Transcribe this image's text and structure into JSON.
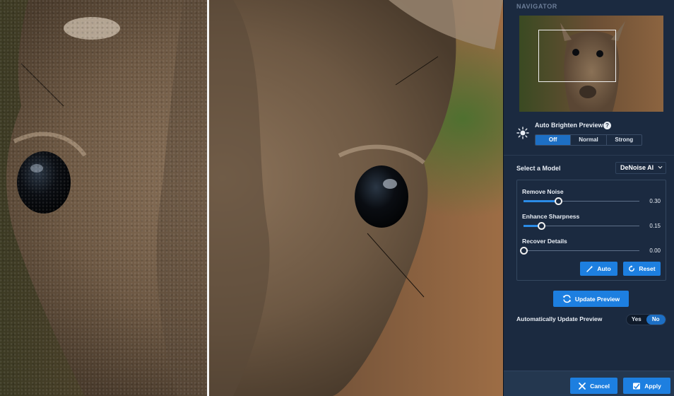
{
  "navigator": {
    "title": "NAVIGATOR"
  },
  "brighten": {
    "label": "Auto Brighten Preview",
    "help": "?",
    "options": [
      "Off",
      "Normal",
      "Strong"
    ],
    "selected": "Off"
  },
  "model": {
    "label": "Select a Model",
    "value": "DeNoise AI"
  },
  "sliders": [
    {
      "label": "Remove Noise",
      "value": "0.30",
      "fraction": 0.3
    },
    {
      "label": "Enhance Sharpness",
      "value": "0.15",
      "fraction": 0.15
    },
    {
      "label": "Recover Details",
      "value": "0.00",
      "fraction": 0.0
    }
  ],
  "actions": {
    "auto_label": "Auto",
    "reset_label": "Reset",
    "update_preview_label": "Update Preview"
  },
  "auto_update": {
    "label": "Automatically Update Preview",
    "options": [
      "Yes",
      "No"
    ],
    "selected": "No"
  },
  "footer": {
    "cancel_label": "Cancel",
    "apply_label": "Apply"
  },
  "colors": {
    "accent": "#1d7fe0",
    "panel": "#1b2a40",
    "footer": "#24374f"
  }
}
